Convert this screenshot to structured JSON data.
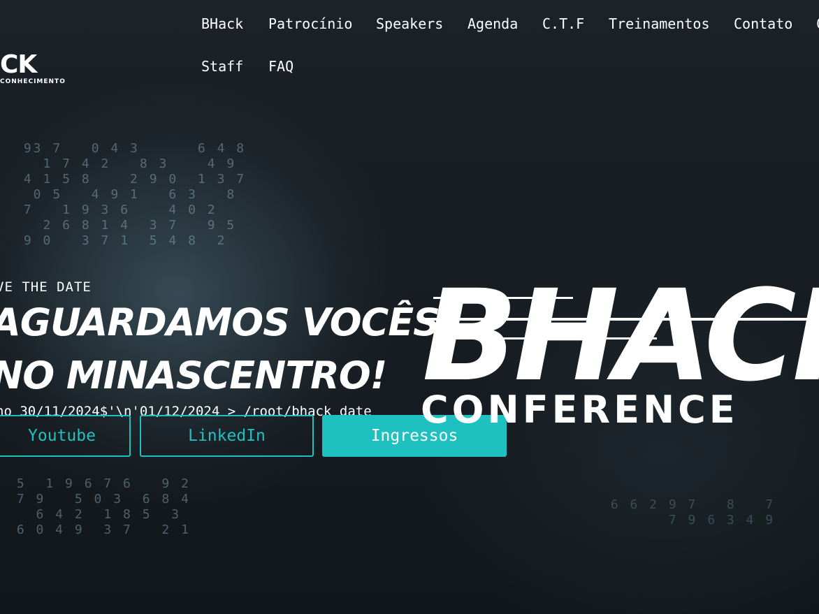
{
  "logo": {
    "name": "BHACK",
    "visible_text": "CK",
    "tagline": "CONHECIMENTO"
  },
  "nav": {
    "items": [
      {
        "label": "BHack"
      },
      {
        "label": "Patrocínio"
      },
      {
        "label": "Speakers"
      },
      {
        "label": "Agenda"
      },
      {
        "label": "C.T.F"
      },
      {
        "label": "Treinamentos"
      },
      {
        "label": "Contato"
      },
      {
        "label": "C"
      },
      {
        "label": "Staff"
      },
      {
        "label": "FAQ"
      }
    ]
  },
  "hero": {
    "eyebrow": "VE THE DATE",
    "headline_line1": "AGUARDAMOS VOCÊS",
    "headline_line2": "NO MINASCENTRO!",
    "date_line": "ho 30/11/2024$'\\n'01/12/2024 > /root/bhack_date",
    "buttons": {
      "youtube": "Youtube",
      "linkedin": "LinkedIn",
      "tickets": "Ingressos"
    }
  },
  "brand": {
    "word": "BHACK",
    "subtitle": "CONFERENCE"
  },
  "colors": {
    "accent": "#1fc1c0",
    "background": "#151a1f",
    "text": "#ffffff"
  }
}
